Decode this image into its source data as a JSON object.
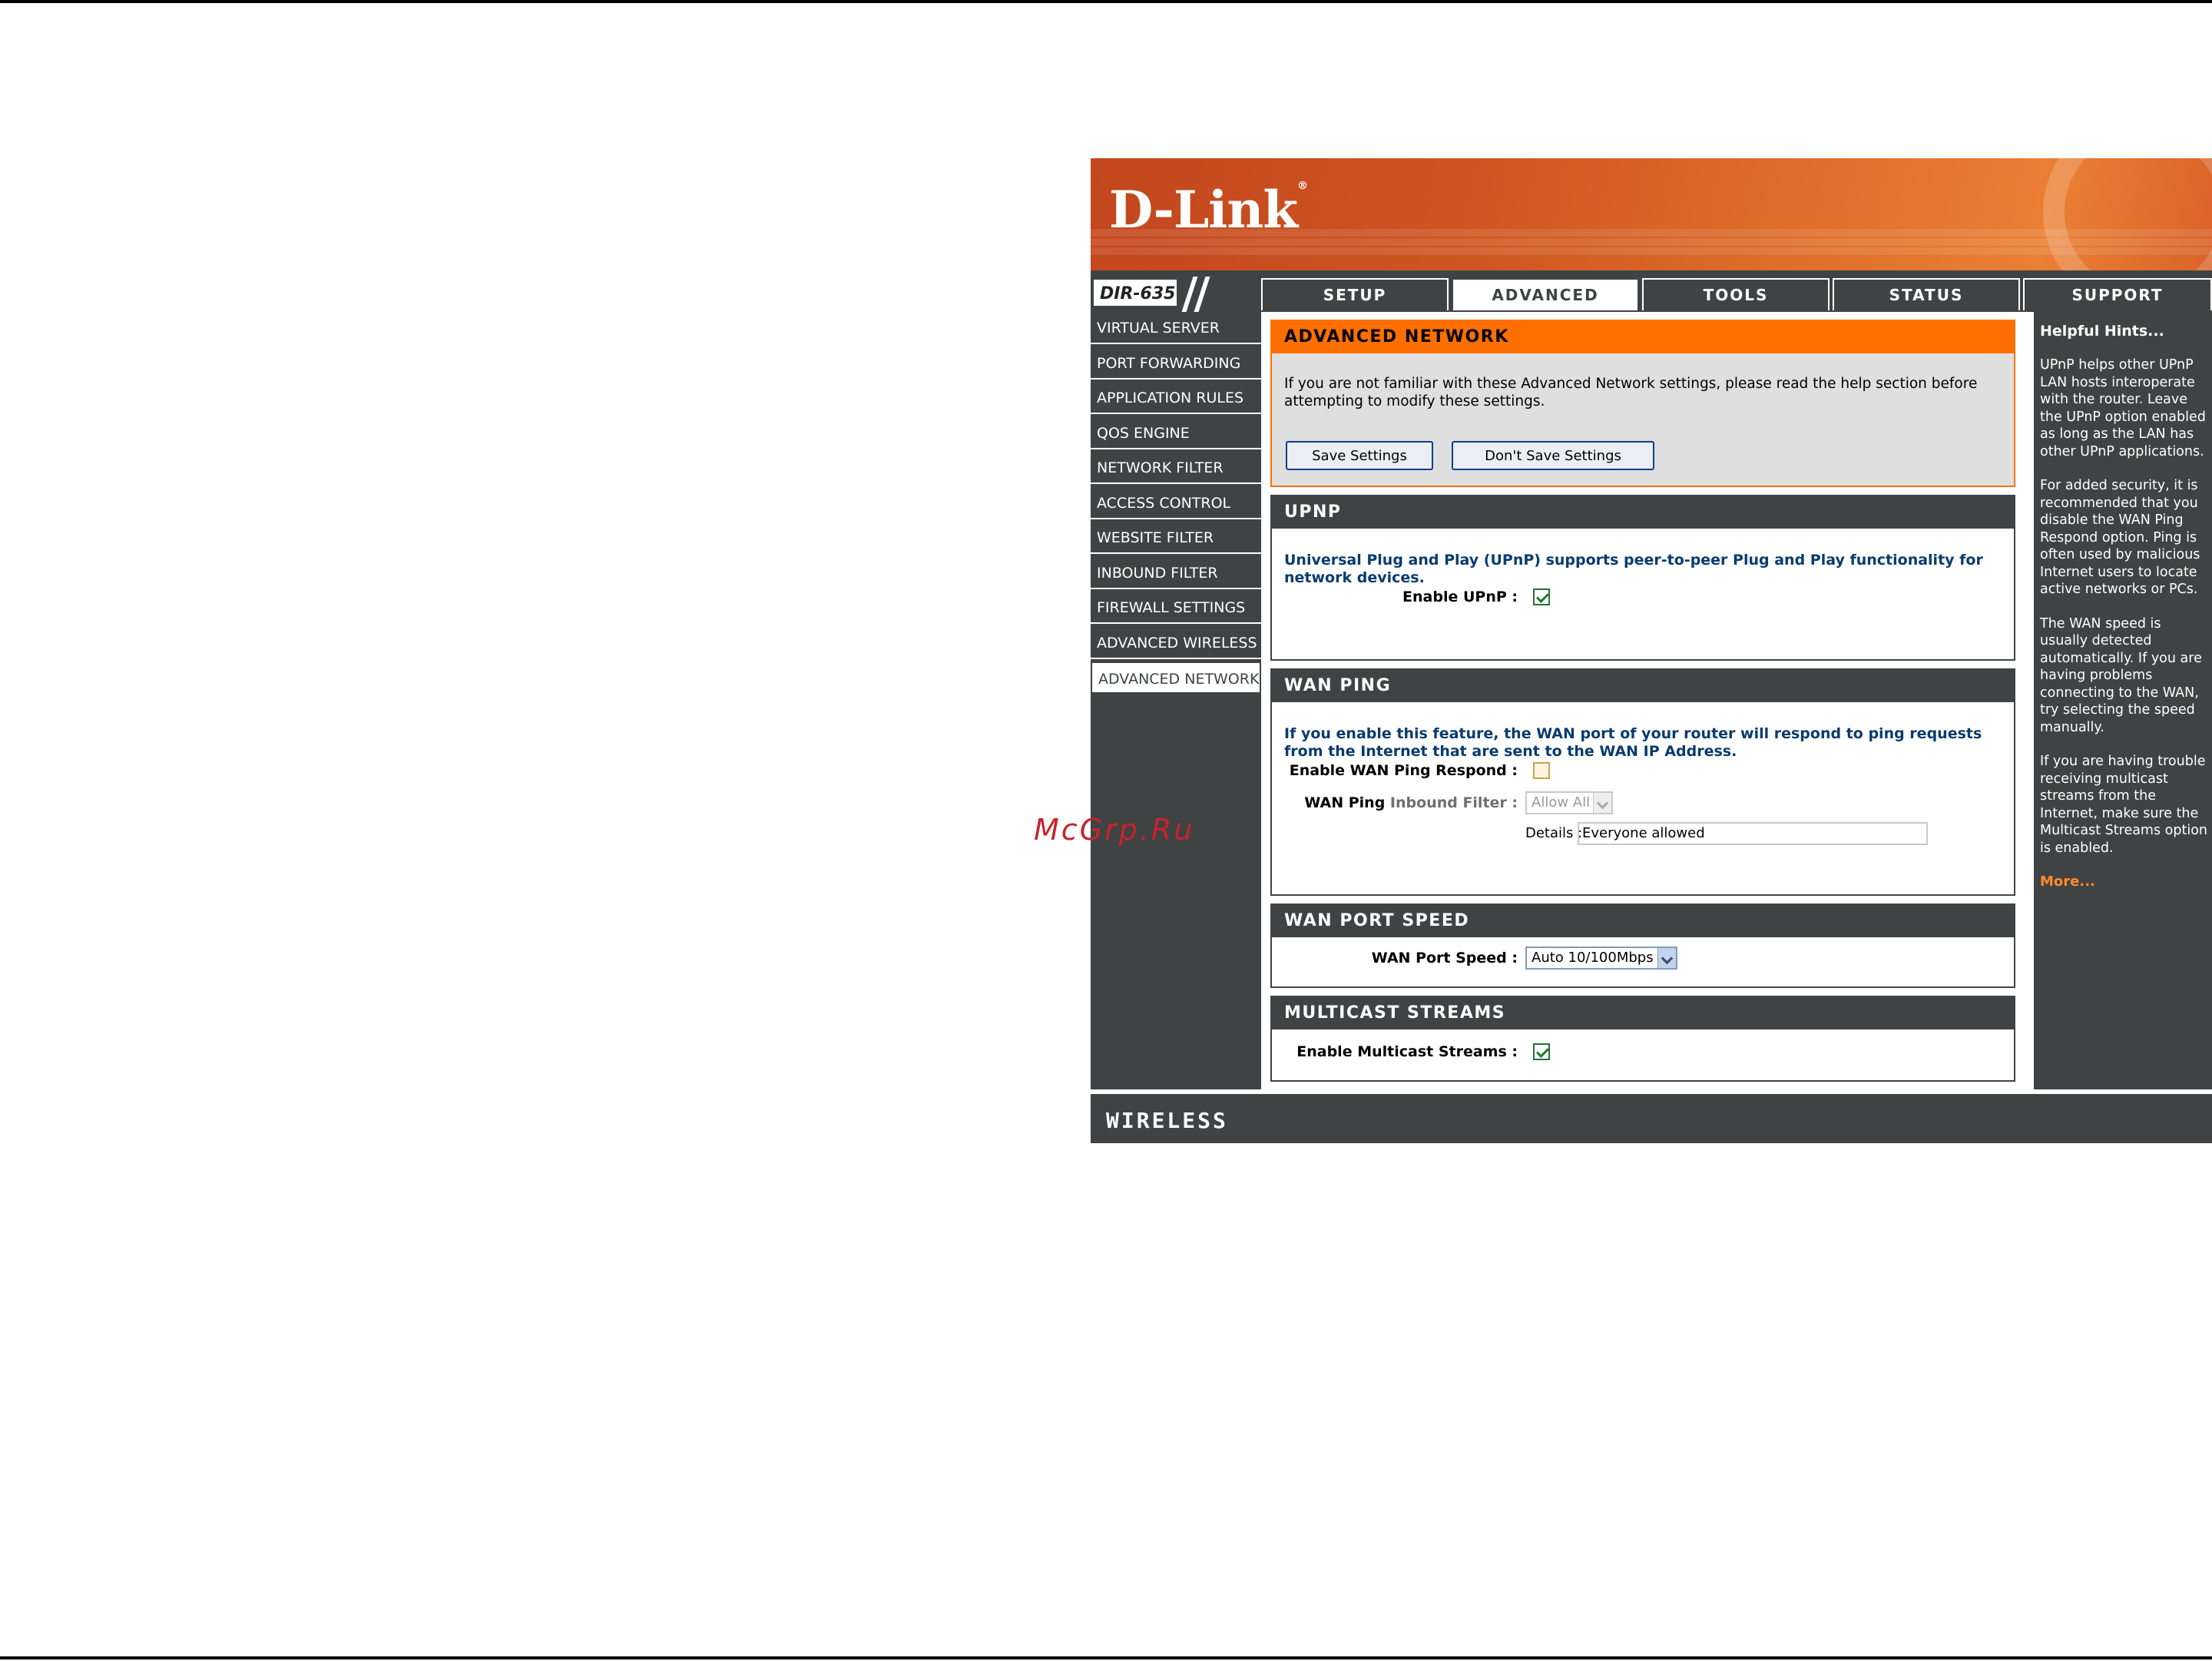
{
  "watermark": "McGrp.Ru",
  "brand": {
    "logo": "D-Link",
    "model": "DIR-635",
    "footer": "WIRELESS"
  },
  "colors": {
    "accent_orange": "#ff6f00",
    "panel_dark": "#404343",
    "hint_link": "#ff8a2b"
  },
  "tabs": [
    {
      "label": "SETUP"
    },
    {
      "label": "ADVANCED"
    },
    {
      "label": "TOOLS"
    },
    {
      "label": "STATUS"
    },
    {
      "label": "SUPPORT"
    }
  ],
  "sidebar": {
    "items": [
      {
        "label": "VIRTUAL SERVER"
      },
      {
        "label": "PORT FORWARDING"
      },
      {
        "label": "APPLICATION RULES"
      },
      {
        "label": "QOS ENGINE"
      },
      {
        "label": "NETWORK FILTER"
      },
      {
        "label": "ACCESS CONTROL"
      },
      {
        "label": "WEBSITE FILTER"
      },
      {
        "label": "INBOUND FILTER"
      },
      {
        "label": "FIREWALL SETTINGS"
      },
      {
        "label": "ADVANCED WIRELESS"
      },
      {
        "label": "ADVANCED NETWORK"
      }
    ]
  },
  "intro": {
    "title": "ADVANCED NETWORK",
    "text": "If you are not familiar with these Advanced Network settings, please read the help section before attempting to modify these settings.",
    "save_label": "Save Settings",
    "dont_save_label": "Don't Save Settings"
  },
  "upnp": {
    "title": "UPNP",
    "description": "Universal Plug and Play (UPnP) supports peer-to-peer Plug and Play functionality for network devices.",
    "enable_label": "Enable UPnP :",
    "enabled": true
  },
  "wan_ping": {
    "title": "WAN PING",
    "description": "If you enable this feature, the WAN port of your router will respond to ping requests from the Internet that are sent to the WAN IP Address.",
    "respond_label": "Enable WAN Ping Respond :",
    "respond_enabled": false,
    "filter_label_a": "WAN Ping",
    "filter_label_b": "Inbound Filter :",
    "filter_value": "Allow All",
    "details_label": "Details :",
    "details_value": "Everyone allowed"
  },
  "wan_speed": {
    "title": "WAN PORT SPEED",
    "label": "WAN Port Speed :",
    "value": "Auto 10/100Mbps"
  },
  "multicast": {
    "title": "MULTICAST STREAMS",
    "label": "Enable Multicast Streams :",
    "enabled": true
  },
  "help": {
    "title": "Helpful Hints...",
    "hints": [
      "UPnP helps other UPnP LAN hosts interoperate with the router. Leave the UPnP option enabled as long as the LAN has other UPnP applications.",
      "For added security, it is recommended that you disable the WAN Ping Respond option. Ping is often used by malicious Internet users to locate active networks or PCs.",
      "The WAN speed is usually detected automatically. If you are having problems connecting to the WAN, try selecting the speed manually.",
      "If you are having trouble receiving multicast streams from the Internet, make sure the Multicast Streams option is enabled."
    ],
    "more": "More..."
  }
}
